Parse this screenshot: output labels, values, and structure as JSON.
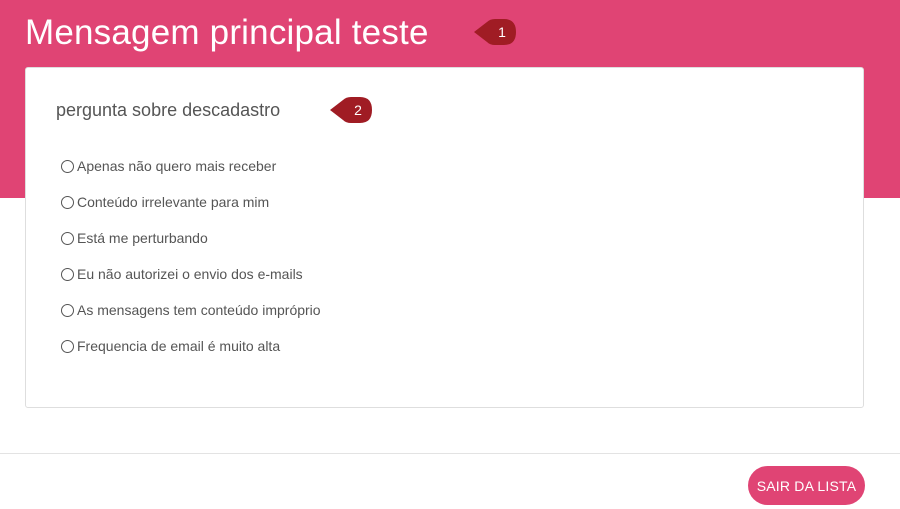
{
  "colors": {
    "accent": "#e04474",
    "marker": "#a01c24",
    "text": "#555555",
    "card_border": "#dedede"
  },
  "header": {
    "title": "Mensagem principal teste",
    "marker_number": "1"
  },
  "question": {
    "text": "pergunta sobre descadastro",
    "marker_number": "2"
  },
  "options": [
    {
      "label": "Apenas não quero mais receber",
      "selected": false
    },
    {
      "label": "Conteúdo irrelevante para mim",
      "selected": false
    },
    {
      "label": "Está me perturbando",
      "selected": false
    },
    {
      "label": "Eu não autorizei o envio dos e-mails",
      "selected": false
    },
    {
      "label": "As mensagens tem conteúdo impróprio",
      "selected": false
    },
    {
      "label": "Frequencia de email é muito alta",
      "selected": false
    }
  ],
  "footer": {
    "exit_button_label": "SAIR DA LISTA"
  }
}
